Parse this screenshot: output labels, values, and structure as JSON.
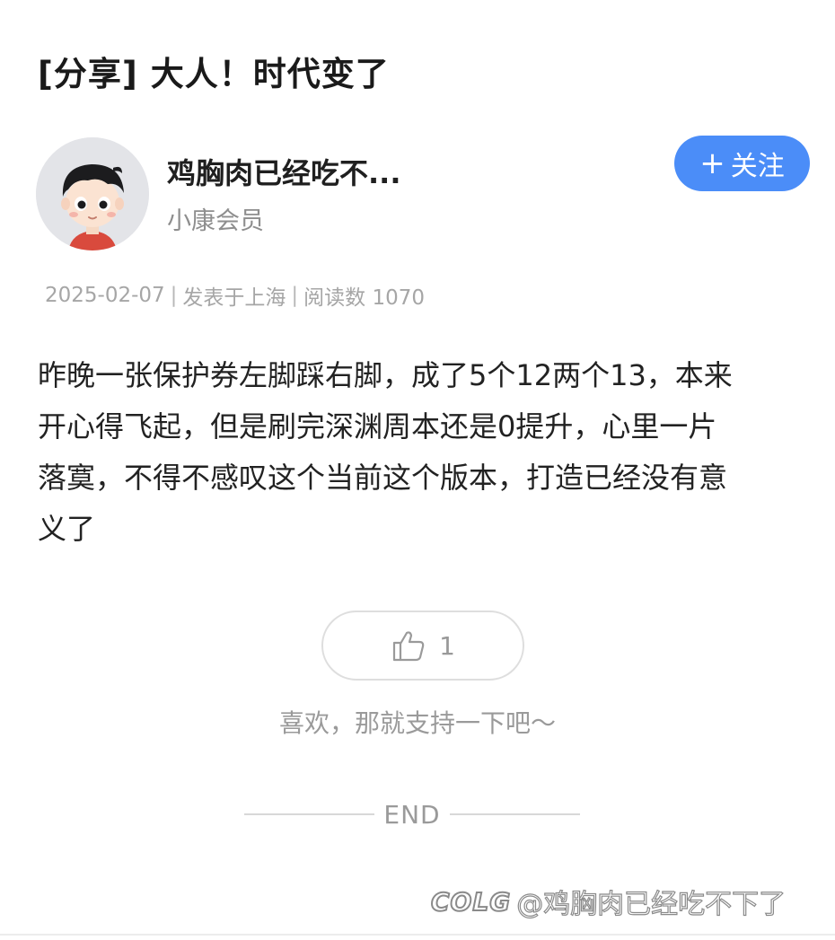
{
  "post": {
    "title": "[分享] 大人！时代变了",
    "body": "昨晚一张保护券左脚踩右脚，成了5个12两个13，本来\n开心得飞起，但是刷完深渊周本还是0提升，心里一片\n落寞，不得不感叹这个当前这个版本，打造已经没有意\n义了"
  },
  "author": {
    "name": "鸡胸肉已经吃不...",
    "level": "小康会员",
    "avatar_icon": "cartoon-avatar-icon"
  },
  "follow": {
    "plus": "+",
    "label": "关注",
    "color": "#4b8df8"
  },
  "meta": {
    "date": "2025-02-07",
    "location": "发表于上海",
    "reads": "阅读数 1070",
    "separator": "|"
  },
  "like": {
    "icon": "thumbs-up-icon",
    "count": "1",
    "hint": "喜欢，那就支持一下吧～"
  },
  "footer": {
    "end_label": "END"
  },
  "watermark": {
    "logo": "COLG",
    "text": "@鸡胸肉已经吃不下了"
  }
}
